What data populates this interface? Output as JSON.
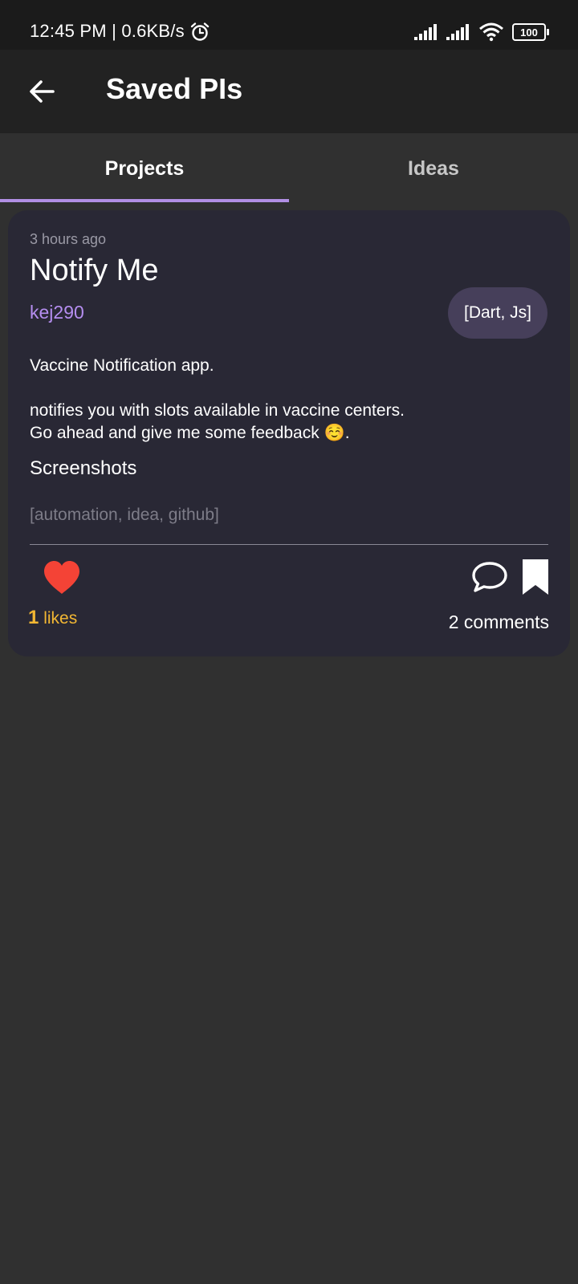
{
  "status_bar": {
    "time": "12:45 PM",
    "speed": "0.6KB/s",
    "battery": "100"
  },
  "app_bar": {
    "title": "Saved PIs"
  },
  "tabs": [
    {
      "label": "Projects",
      "active": true
    },
    {
      "label": "Ideas",
      "active": false
    }
  ],
  "post": {
    "time_ago": "3 hours ago",
    "title": "Notify Me",
    "author": "kej290",
    "languages": "[Dart, Js]",
    "description_line1": "Vaccine Notification app.",
    "description_line2": "notifies you with slots available in vaccine centers.",
    "description_line3": "Go ahead and give me some feedback ☺️.",
    "screenshots_label": "Screenshots",
    "tags": "[automation, idea, github]",
    "likes_count": "1",
    "likes_label": "likes",
    "comments_text": "2 comments"
  },
  "colors": {
    "accent": "#b18fe3",
    "card_bg": "#292835",
    "like_red": "#f44336",
    "likes_yellow": "#f2b733"
  }
}
